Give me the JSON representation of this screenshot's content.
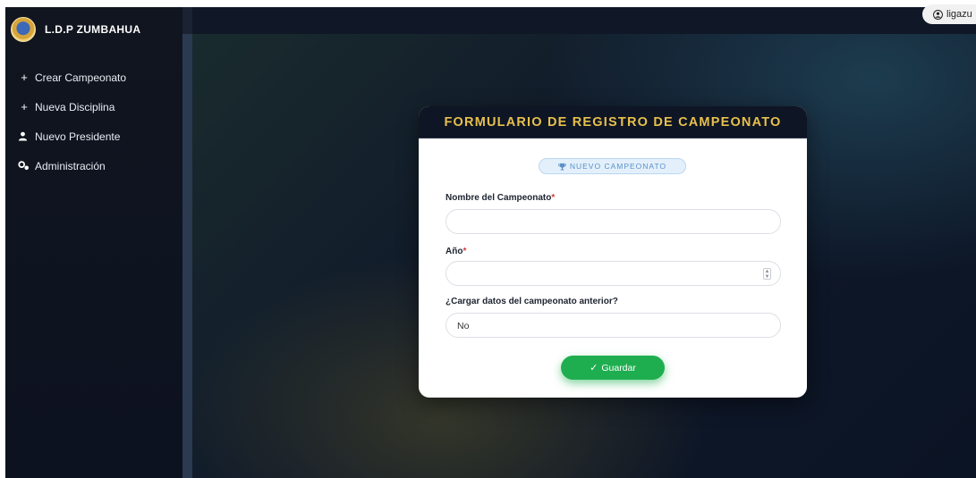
{
  "brand": {
    "name": "L.D.P ZUMBAHUA",
    "logo_icon": "league-logo-icon"
  },
  "sidebar": {
    "items": [
      {
        "icon": "plus-icon",
        "glyph": "+",
        "label": "Crear Campeonato"
      },
      {
        "icon": "plus-icon",
        "glyph": "+",
        "label": "Nueva Disciplina"
      },
      {
        "icon": "user-icon",
        "glyph": "",
        "label": "Nuevo Presidente"
      },
      {
        "icon": "gears-icon",
        "glyph": "",
        "label": "Administración"
      }
    ]
  },
  "user": {
    "name": "ligazu",
    "icon": "user-circle-icon"
  },
  "form": {
    "title": "FORMULARIO DE REGISTRO DE CAMPEONATO",
    "badge": {
      "icon": "trophy-icon",
      "text": "NUEVO CAMPEONATO"
    },
    "fields": {
      "name": {
        "label": "Nombre del Campeonato",
        "required_mark": "*",
        "value": ""
      },
      "year": {
        "label": "Año",
        "required_mark": "*",
        "value": ""
      },
      "load_previous": {
        "label": "¿Cargar datos del campeonato anterior?",
        "value": "No"
      }
    },
    "save_button": {
      "icon": "check-icon",
      "label": "Guardar"
    }
  },
  "colors": {
    "accent_gold": "#e7c04d",
    "save_green": "#1fae4f",
    "sidebar_bg": "#10151f",
    "required": "#d43b3b"
  }
}
